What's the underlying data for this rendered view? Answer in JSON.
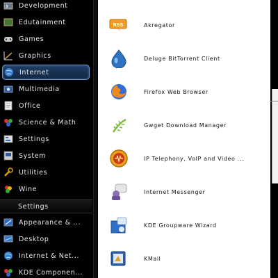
{
  "categories": [
    {
      "label": "Development",
      "icon": "development-icon"
    },
    {
      "label": "Edutainment",
      "icon": "edutainment-icon"
    },
    {
      "label": "Games",
      "icon": "games-icon"
    },
    {
      "label": "Graphics",
      "icon": "graphics-icon"
    },
    {
      "label": "Internet",
      "icon": "internet-icon",
      "selected": true
    },
    {
      "label": "Multimedia",
      "icon": "multimedia-icon"
    },
    {
      "label": "Office",
      "icon": "office-icon"
    },
    {
      "label": "Science & Math",
      "icon": "science-icon"
    },
    {
      "label": "Settings",
      "icon": "settings-icon"
    },
    {
      "label": "System",
      "icon": "system-icon"
    },
    {
      "label": "Utilities",
      "icon": "utilities-icon"
    },
    {
      "label": "Wine",
      "icon": "wine-icon"
    }
  ],
  "settings_section": {
    "title": "Settings",
    "items": [
      {
        "label": "Appearance & ...",
        "icon": "appearance-icon"
      },
      {
        "label": "Desktop",
        "icon": "desktop-icon"
      },
      {
        "label": "Internet & Net...",
        "icon": "internet-network-icon"
      },
      {
        "label": "KDE Componen...",
        "icon": "kde-components-icon"
      }
    ]
  },
  "apps": [
    {
      "label": "Akregator",
      "icon": "rss-feed-icon"
    },
    {
      "label": "Deluge BitTorrent Client",
      "icon": "deluge-icon"
    },
    {
      "label": "Firefox Web Browser",
      "icon": "firefox-icon"
    },
    {
      "label": "Gwget Download Manager",
      "icon": "gwget-icon"
    },
    {
      "label": "IP Telephony, VoIP and Video ...",
      "icon": "telephony-icon"
    },
    {
      "label": "Internet Messenger",
      "icon": "messenger-icon"
    },
    {
      "label": "KDE Groupware Wizard",
      "icon": "groupware-wizard-icon"
    },
    {
      "label": "KMail",
      "icon": "kmail-icon"
    }
  ],
  "colors": {
    "selected_bg": "#1f3f66",
    "selected_border": "#6f95c2",
    "list_bg": "#ffffff",
    "menu_bg": "#000000"
  }
}
